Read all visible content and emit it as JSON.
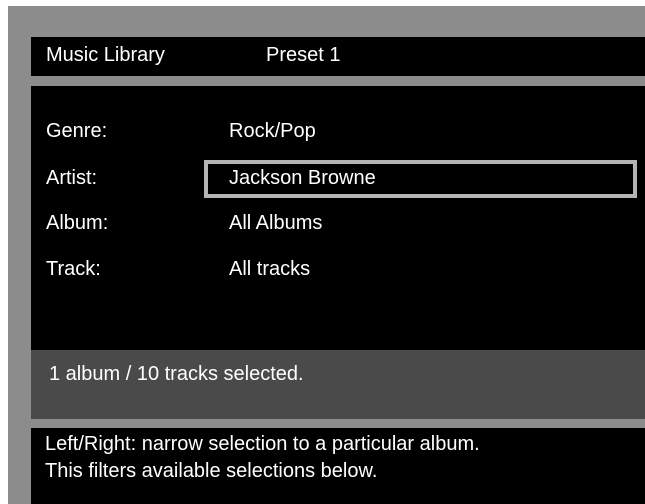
{
  "header": {
    "title": "Music Library",
    "preset": "Preset 1"
  },
  "filters": [
    {
      "label": "Genre:",
      "value": "Rock/Pop",
      "selected": false
    },
    {
      "label": "Artist:",
      "value": "Jackson Browne",
      "selected": true
    },
    {
      "label": "Album:",
      "value": "All Albums",
      "selected": false
    },
    {
      "label": "Track:",
      "value": "All tracks",
      "selected": false
    }
  ],
  "status": {
    "text": "1 album / 10 tracks selected."
  },
  "help": {
    "line1": "Left/Right: narrow selection to a particular album.",
    "line2": "This filters available selections below."
  },
  "colors": {
    "background": "#000000",
    "frame": "#8c8c8c",
    "status_bar": "#4a4a4a",
    "selection_border": "#b4b4b4",
    "text": "#ffffff"
  }
}
